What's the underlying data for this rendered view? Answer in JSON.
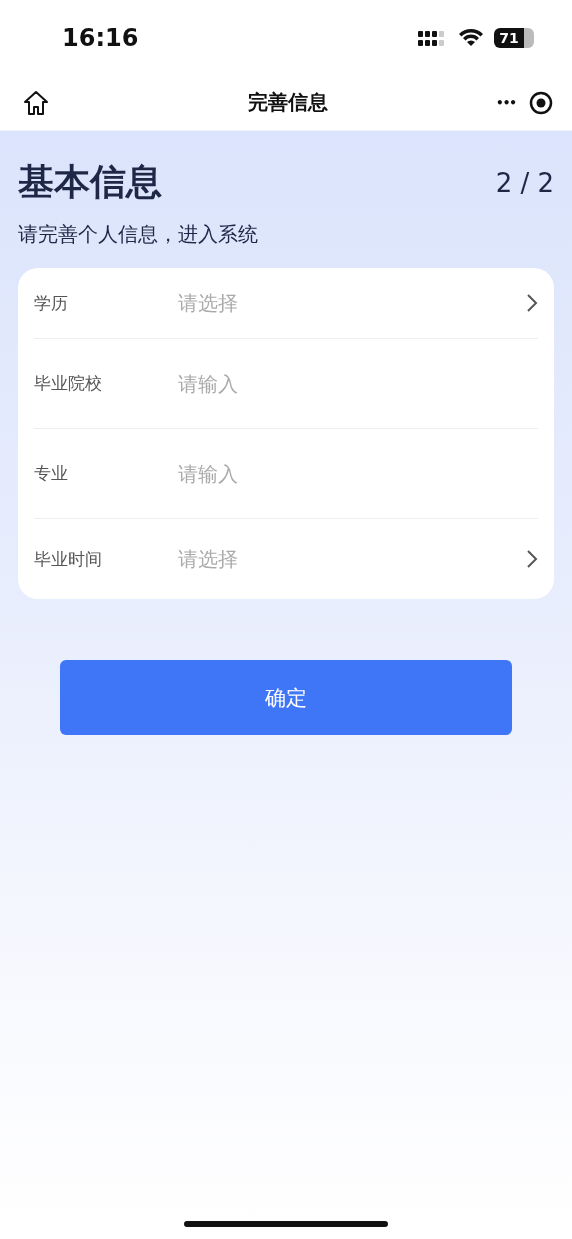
{
  "status_bar": {
    "time": "16:16",
    "battery": "71"
  },
  "nav_bar": {
    "title": "完善信息",
    "more": "•••"
  },
  "header": {
    "title": "基本信息",
    "step": "2 / 2",
    "subtitle": "请完善个人信息，进入系统"
  },
  "form": {
    "fields": [
      {
        "kind": "select",
        "label": "学历",
        "placeholder": "请选择"
      },
      {
        "kind": "input",
        "label": "毕业院校",
        "placeholder": "请输入"
      },
      {
        "kind": "input",
        "label": "专业",
        "placeholder": "请输入"
      },
      {
        "kind": "select",
        "label": "毕业时间",
        "placeholder": "请选择"
      }
    ]
  },
  "submit_button": "确定"
}
